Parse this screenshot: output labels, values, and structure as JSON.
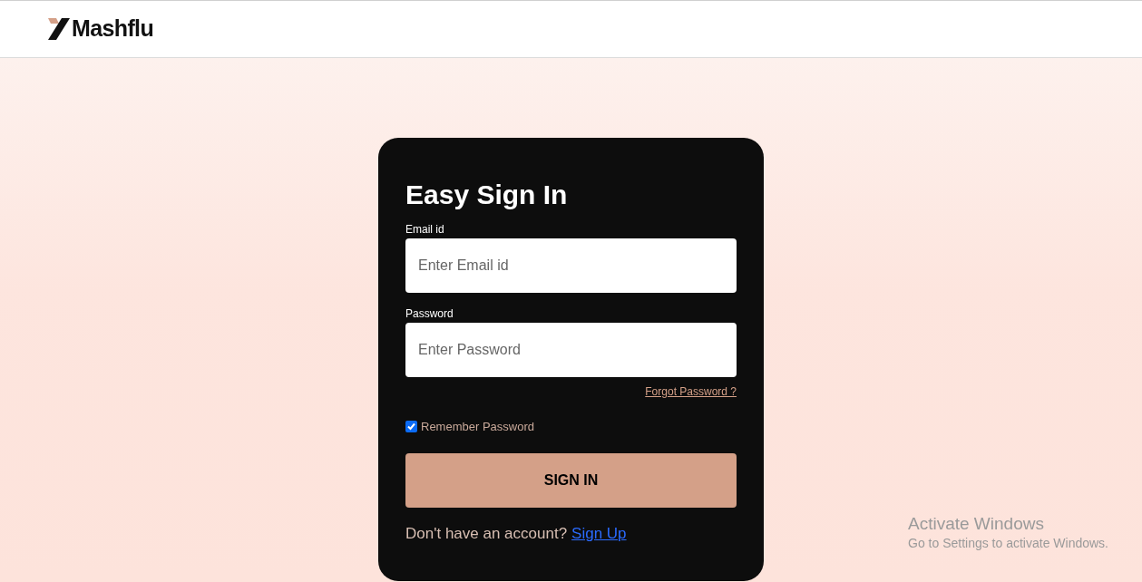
{
  "header": {
    "brand": "Mashflu"
  },
  "form": {
    "title": "Easy Sign In",
    "fields": [
      {
        "label": "Email id",
        "placeholder": "Enter Email id"
      },
      {
        "label": "Password",
        "placeholder": "Enter Password"
      }
    ],
    "forgot_link": "Forgot Password ?",
    "remember": {
      "label": "Remember Password",
      "checked": true
    },
    "submit": "SIGN IN",
    "signup_prompt": "Don't have an account?",
    "signup_link": "Sign Up"
  },
  "os_notice": {
    "title": "Activate Windows",
    "subtitle": "Go to Settings to activate Windows."
  }
}
